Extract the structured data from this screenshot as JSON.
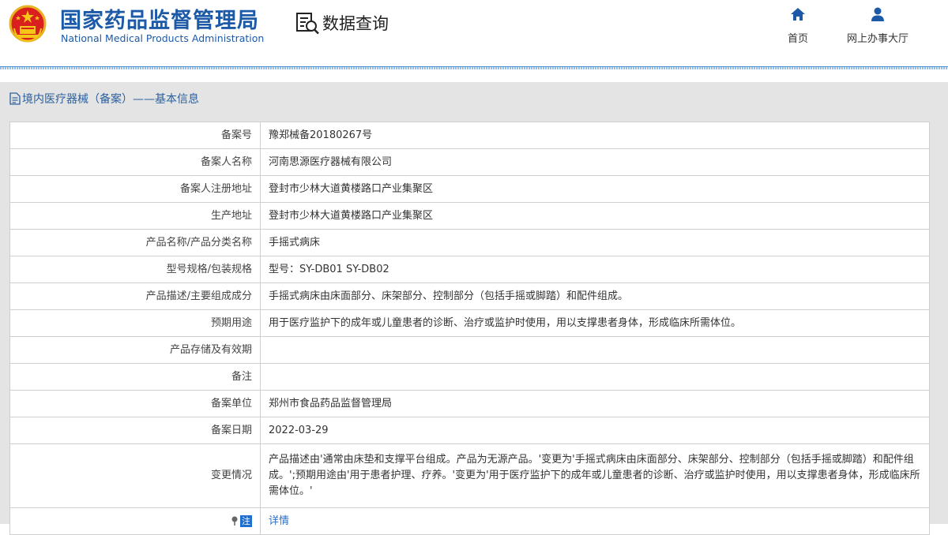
{
  "header": {
    "title_cn": "国家药品监督管理局",
    "title_en": "National Medical Products Administration",
    "data_query_label": "数据查询",
    "nav": {
      "home_label": "首页",
      "hall_label": "网上办事大厅"
    },
    "colors": {
      "brand": "#1c5aa8",
      "nav_icon": "#1c5aa8"
    }
  },
  "panel": {
    "title": "境内医疗器械（备案）——基本信息"
  },
  "rows": [
    {
      "key": "备案号",
      "value": "豫郑械备20180267号"
    },
    {
      "key": "备案人名称",
      "value": "河南思源医疗器械有限公司"
    },
    {
      "key": "备案人注册地址",
      "value": "登封市少林大道黄楼路口产业集聚区"
    },
    {
      "key": "生产地址",
      "value": "登封市少林大道黄楼路口产业集聚区"
    },
    {
      "key": "产品名称/产品分类名称",
      "value": "手摇式病床"
    },
    {
      "key": "型号规格/包装规格",
      "value": "型号：SY-DB01 SY-DB02"
    },
    {
      "key": "产品描述/主要组成成分",
      "value": "手摇式病床由床面部分、床架部分、控制部分（包括手摇或脚踏）和配件组成。"
    },
    {
      "key": "预期用途",
      "value": "用于医疗监护下的成年或儿童患者的诊断、治疗或监护时使用，用以支撑患者身体，形成临床所需体位。"
    },
    {
      "key": "产品存储及有效期",
      "value": ""
    },
    {
      "key": "备注",
      "value": ""
    },
    {
      "key": "备案单位",
      "value": "郑州市食品药品监督管理局"
    },
    {
      "key": "备案日期",
      "value": "2022-03-29"
    },
    {
      "key": "变更情况",
      "value": "产品描述由'通常由床垫和支撑平台组成。产品为无源产品。'变更为'手摇式病床由床面部分、床架部分、控制部分（包括手摇或脚踏）和配件组成。';预期用途由'用于患者护理、疗养。'变更为'用于医疗监护下的成年或儿童患者的诊断、治疗或监护时使用，用以支撑患者身体，形成临床所需体位。'"
    }
  ],
  "detail_row": {
    "icon_badge": "注",
    "link_label": "详情"
  },
  "icons": {
    "emblem": "national-emblem-icon",
    "data_query": "document-search-icon",
    "home": "home-icon",
    "hall": "user-icon",
    "panel_title": "document-icon"
  }
}
